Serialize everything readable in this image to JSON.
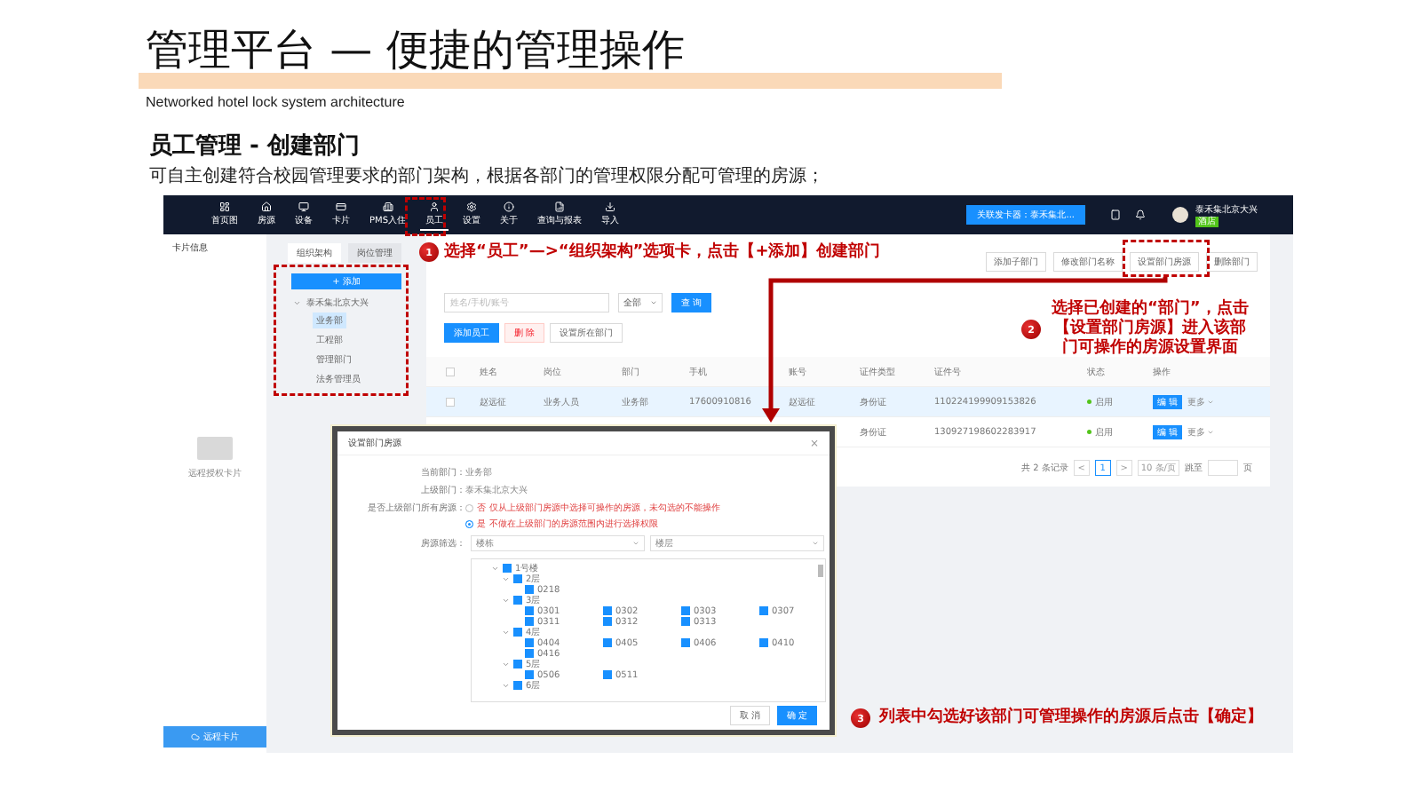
{
  "title": "管理平台 — 便捷的管理操作",
  "subtitle": "Networked hotel lock system architecture",
  "heading": "员工管理 - 创建部门",
  "description": "可自主创建符合校园管理要求的部门架构，根据各部门的管理权限分配可管理的房源；",
  "app": {
    "nav": [
      {
        "label": "首页图",
        "selected": false
      },
      {
        "label": "房源",
        "selected": false
      },
      {
        "label": "设备",
        "selected": false
      },
      {
        "label": "卡片",
        "selected": false
      },
      {
        "label": "PMS入住",
        "selected": false
      },
      {
        "label": "员工",
        "selected": true
      },
      {
        "label": "设置",
        "selected": false
      },
      {
        "label": "关于",
        "selected": false
      },
      {
        "label": "查询与报表",
        "selected": false
      },
      {
        "label": "导入",
        "selected": false
      }
    ],
    "device_button": "关联发卡器：泰禾集北...",
    "user": {
      "name": "泰禾集北京大兴",
      "badge": "酒店"
    },
    "sidebar": {
      "title": "卡片信息",
      "card_label": "远程授权卡片",
      "bottom_button": "远程卡片"
    },
    "org_tabs": [
      {
        "label": "组织架构",
        "selected": true
      },
      {
        "label": "岗位管理",
        "selected": false
      }
    ],
    "add_button": "+ 添加",
    "tree": {
      "label": "泰禾集北京大兴",
      "expanded": true,
      "children": [
        {
          "label": "业务部",
          "selected": true
        },
        {
          "label": "工程部",
          "selected": false
        },
        {
          "label": "管理部门",
          "selected": false
        },
        {
          "label": "法务管理员",
          "selected": false
        }
      ]
    },
    "dept_actions": [
      "添加子部门",
      "修改部门名称",
      "设置部门房源",
      "删除部门"
    ],
    "search": {
      "placeholder": "姓名/手机/账号",
      "filter": "全部",
      "button": "查 询"
    },
    "table_actions": [
      {
        "label": "添加员工",
        "kind": "primary"
      },
      {
        "label": "删 除",
        "kind": "danger"
      },
      {
        "label": "设置所在部门",
        "kind": "plain"
      }
    ],
    "select_all": false,
    "columns": [
      "姓名",
      "岗位",
      "部门",
      "手机",
      "账号",
      "证件类型",
      "证件号",
      "状态",
      "操作"
    ],
    "rows": [
      {
        "selected": true,
        "checked": false,
        "cells": [
          "赵远征",
          "业务人员",
          "业务部",
          "17600910816",
          "赵远征",
          "身份证",
          "110224199909153826"
        ],
        "status": "启用",
        "enabled": true,
        "edit": "编 辑",
        "more": "更多"
      },
      {
        "selected": false,
        "cells": [
          null,
          null,
          null,
          null,
          null,
          "身份证",
          "130927198602283917"
        ],
        "status": "启用",
        "enabled": true,
        "edit": "编 辑",
        "more": "更多"
      }
    ],
    "pagination": {
      "total": "共 2 条记录",
      "prev": "<",
      "pages": [
        {
          "label": "1",
          "selected": true
        }
      ],
      "next": ">",
      "page_size": "10 条/页",
      "jump": "跳至",
      "unit": "页"
    }
  },
  "dialog": {
    "title": "设置部门房源",
    "close": "×",
    "fields": [
      {
        "label": "当前部门：",
        "value": "业务部"
      },
      {
        "label": "上级部门：",
        "value": "泰禾集北京大兴"
      }
    ],
    "radio_label": "是否上级部门所有房源：",
    "radios": [
      {
        "label": "否",
        "note": "仅从上级部门房源中选择可操作的房源，未勾选的不能操作",
        "selected": false
      },
      {
        "label": "是",
        "note": "不做在上级部门的房源范围内进行选择权限",
        "selected": true
      }
    ],
    "filter_label": "房源筛选：",
    "selects": [
      "楼栋",
      "楼层"
    ],
    "tree": {
      "label": "1号楼",
      "checked": true,
      "expanded": true,
      "children": [
        {
          "label": "2层",
          "checked": true,
          "expanded": true,
          "rooms": [
            {
              "label": "0218",
              "checked": true
            }
          ]
        },
        {
          "label": "3层",
          "checked": true,
          "expanded": true,
          "rooms": [
            {
              "label": "0301",
              "checked": true
            },
            {
              "label": "0302",
              "checked": true
            },
            {
              "label": "0303",
              "checked": true
            },
            {
              "label": "0307",
              "checked": true
            },
            {
              "label": "0311",
              "checked": true
            },
            {
              "label": "0312",
              "checked": true
            },
            {
              "label": "0313",
              "checked": true
            }
          ]
        },
        {
          "label": "4层",
          "checked": true,
          "expanded": true,
          "rooms": [
            {
              "label": "0404",
              "checked": true
            },
            {
              "label": "0405",
              "checked": true
            },
            {
              "label": "0406",
              "checked": true
            },
            {
              "label": "0410",
              "checked": true
            },
            {
              "label": "0416",
              "checked": true
            }
          ]
        },
        {
          "label": "5层",
          "checked": true,
          "expanded": true,
          "rooms": [
            {
              "label": "0506",
              "checked": true
            },
            {
              "label": "0511",
              "checked": true
            }
          ]
        },
        {
          "label": "6层",
          "checked": true,
          "expanded": true
        }
      ]
    },
    "buttons": [
      {
        "label": "取 消",
        "kind": "plain"
      },
      {
        "label": "确 定",
        "kind": "primary"
      }
    ]
  },
  "callouts": [
    {
      "number": "1",
      "lines": [
        "选择“员工”—>“组织架构”选项卡，点击【+添加】创建部门"
      ]
    },
    {
      "number": "2",
      "lines": [
        "选择已创建的“部门”，点击",
        "【设置部门房源】进入该部",
        "门可操作的房源设置界面"
      ]
    },
    {
      "number": "3",
      "lines": [
        "列表中勾选好该部门可管理操作的房源后点击【确定】"
      ]
    }
  ]
}
